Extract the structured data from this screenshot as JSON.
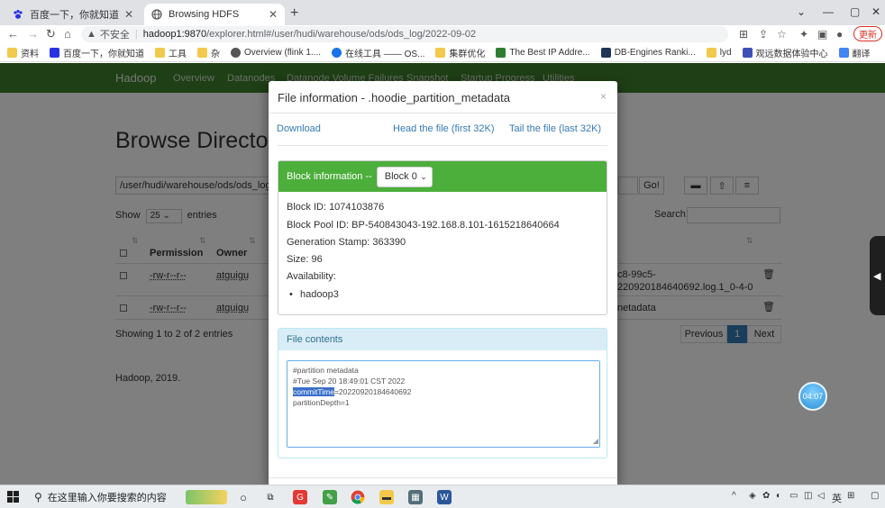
{
  "browser": {
    "tabs": [
      {
        "title": "百度一下，你就知道",
        "active": false
      },
      {
        "title": "Browsing HDFS",
        "active": true
      }
    ],
    "address": {
      "security_label": "不安全",
      "host": "hadoop1:9870",
      "path": "/explorer.html#/user/hudi/warehouse/ods/ods_log/2022-09-02"
    },
    "update_label": "更新",
    "bookmarks": [
      "资料",
      "百度一下，你就知道",
      "工具",
      "杂",
      "Overview (flink 1....",
      "在线工具 —— OS...",
      "集群优化",
      "The Best IP Addre...",
      "DB-Engines Ranki...",
      "lyd",
      "观远数据体验中心",
      "翻译"
    ]
  },
  "page": {
    "brand": "Hadoop",
    "nav": [
      "Overview",
      "Datanodes",
      "Datanode Volume Failures",
      "Snapshot",
      "Startup Progress",
      "Utilities"
    ],
    "title": "Browse Directo",
    "path_value": "/user/hudi/warehouse/ods/ods_log/2",
    "go_label": "Go!",
    "show_label": "Show",
    "show_value": "25",
    "entries_label": "entries",
    "search_label": "Search:",
    "columns": [
      "Permission",
      "Owner"
    ],
    "rows": [
      {
        "permission": "-rw-r--r--",
        "owner": "atguigu",
        "name_line1": "c8-99c5-",
        "name_line2": "220920184640692.log.1_0-4-0"
      },
      {
        "permission": "-rw-r--r--",
        "owner": "atguigu",
        "name_line1": "netadata",
        "name_line2": ""
      }
    ],
    "showing": "Showing 1 to 2 of 2 entries",
    "pager": {
      "previous": "Previous",
      "current": "1",
      "next": "Next"
    },
    "footer": "Hadoop, 2019."
  },
  "modal": {
    "title": "File information - .hoodie_partition_metadata",
    "close": "×",
    "links": {
      "download": "Download",
      "head": "Head the file (first 32K)",
      "tail": "Tail the file (last 32K)"
    },
    "block_label": "Block information --",
    "block_select": "Block 0",
    "block_id": "Block ID: 1074103876",
    "pool_id": "Block Pool ID: BP-540843043-192.168.8.101-1615218640664",
    "gen_stamp": "Generation Stamp: 363390",
    "size": "Size: 96",
    "availability": "Availability:",
    "hosts": [
      "hadoop3"
    ],
    "contents_label": "File contents",
    "contents": {
      "line1": "#partition metadata",
      "line2": "#Tue Sep 20 18:49:01 CST 2022",
      "line3_key": "commitTime",
      "line3_val": "=20220920184640692",
      "line4": "partitionDepth=1"
    }
  },
  "timer": "04:07",
  "taskbar": {
    "search_placeholder": "在这里输入你要搜索的内容",
    "ime": "英"
  }
}
